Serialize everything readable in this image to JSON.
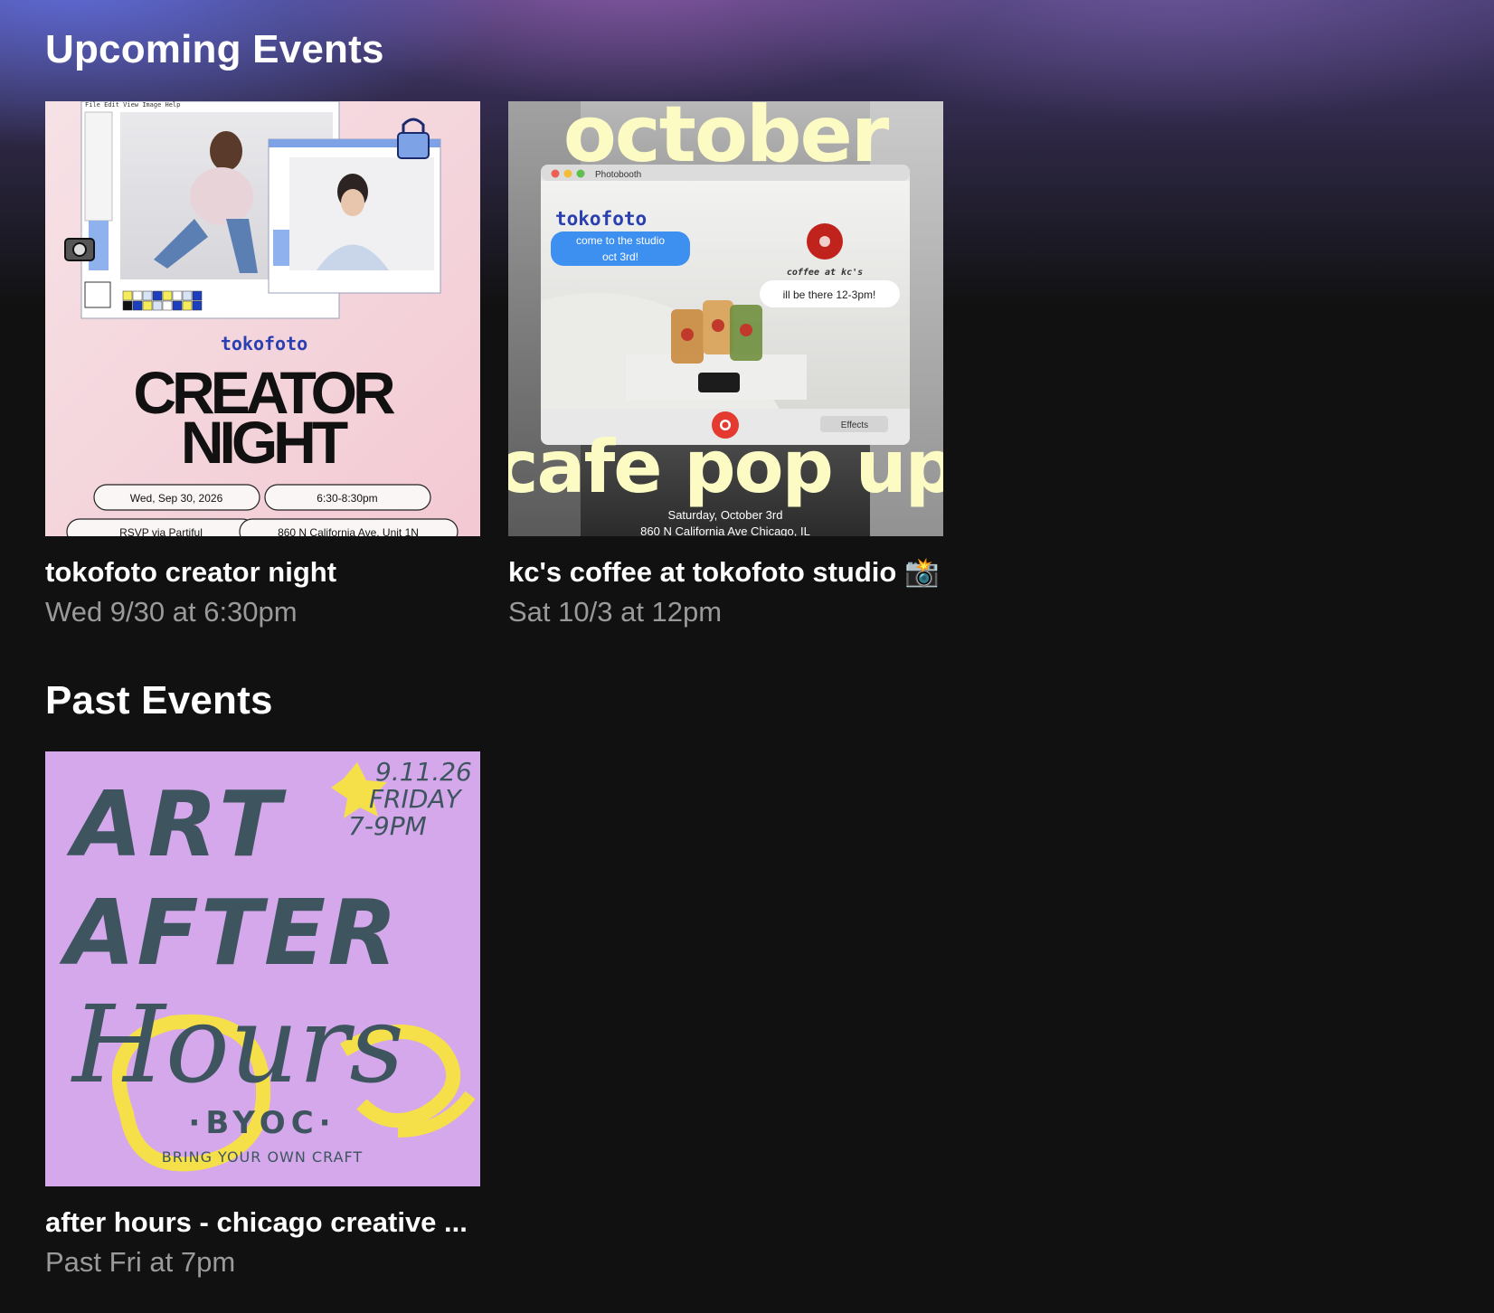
{
  "upcoming": {
    "heading": "Upcoming Events",
    "events": [
      {
        "title": "tokofoto creator night",
        "time": "Wed 9/30 at 6:30pm",
        "poster": {
          "brand": "tokofoto",
          "headline_1": "CREATOR",
          "headline_2": "NIGHT",
          "menu": "File Edit View Image Help",
          "pill_date": "Wed, Sep 30, 2026",
          "pill_time": "6:30-8:30pm",
          "pill_rsvp": "RSVP via Partiful",
          "pill_address": "860 N California Ave, Unit 1N",
          "colors": {
            "bg": "#f4d6dd",
            "ink": "#111111",
            "brand": "#2a3fb0"
          }
        }
      },
      {
        "title": "kc's coffee at tokofoto studio 📸",
        "time": "Sat 10/3 at 12pm",
        "poster": {
          "headline_top": "october",
          "headline_bottom": "cafe pop up",
          "window_title": "Photobooth",
          "brand": "tokofoto",
          "bubble_left_1": "come to the studio",
          "bubble_left_2": "oct 3rd!",
          "coffee_label": "coffee at kc's",
          "bubble_right": "ill be there 12-3pm!",
          "effects_label": "Effects",
          "date_line": "Saturday, October 3rd",
          "address_line": "860 N California Ave Chicago, IL",
          "colors": {
            "headline": "#fdfbc4",
            "bubble": "#3d8ff0"
          }
        }
      }
    ]
  },
  "past": {
    "heading": "Past Events",
    "events": [
      {
        "title": "after hours - chicago creative ...",
        "time": "Past Fri at 7pm",
        "poster": {
          "line_1": "ART",
          "line_2": "AFTER",
          "line_3": "Hours",
          "date": "9.11.26",
          "day": "FRIDAY",
          "hours": "7-9PM",
          "byoc": "·BYOC·",
          "byoc_full": "BRING YOUR OWN CRAFT",
          "colors": {
            "bg": "#d4a8ea",
            "ink": "#3e5560",
            "accent": "#f6e04a"
          }
        }
      }
    ]
  }
}
